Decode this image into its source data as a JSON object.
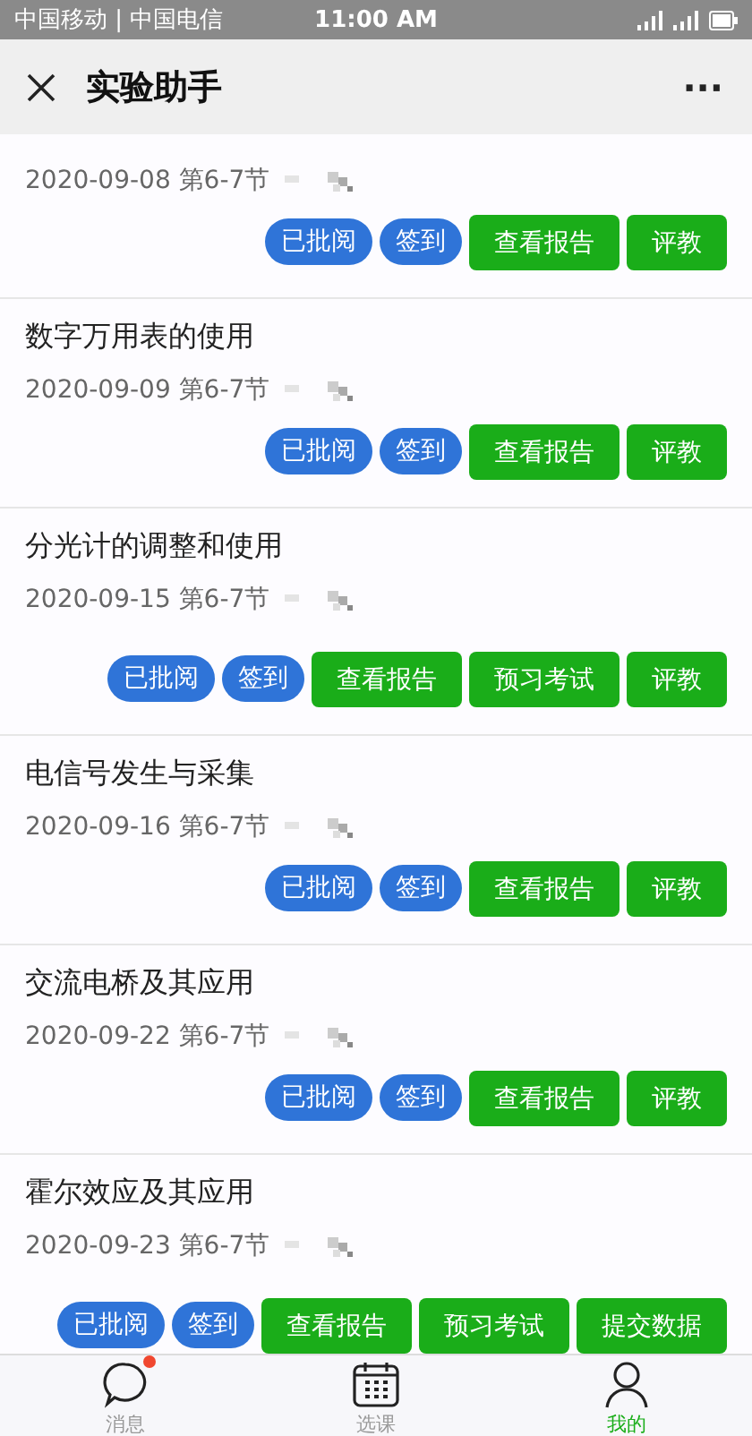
{
  "status_bar": {
    "carriers": "中国移动 | 中国电信",
    "time": "11:00 AM"
  },
  "header": {
    "title": "实验助手",
    "more": "···"
  },
  "experiments": [
    {
      "date": "2020-09-08 第6-7节",
      "actions": [
        {
          "label": "已批阅",
          "kind": "status"
        },
        {
          "label": "签到",
          "kind": "status"
        },
        {
          "label": "查看报告",
          "kind": "action"
        },
        {
          "label": "评教",
          "kind": "action"
        }
      ]
    },
    {
      "title": "数字万用表的使用",
      "date": "2020-09-09 第6-7节",
      "actions": [
        {
          "label": "已批阅",
          "kind": "status"
        },
        {
          "label": "签到",
          "kind": "status"
        },
        {
          "label": "查看报告",
          "kind": "action"
        },
        {
          "label": "评教",
          "kind": "action"
        }
      ]
    },
    {
      "title": "分光计的调整和使用",
      "date": "2020-09-15 第6-7节",
      "actions": [
        {
          "label": "已批阅",
          "kind": "status"
        },
        {
          "label": "签到",
          "kind": "status"
        },
        {
          "label": "查看报告",
          "kind": "action"
        },
        {
          "label": "预习考试",
          "kind": "action"
        },
        {
          "label": "评教",
          "kind": "action"
        }
      ]
    },
    {
      "title": "电信号发生与采集",
      "date": "2020-09-16 第6-7节",
      "actions": [
        {
          "label": "已批阅",
          "kind": "status"
        },
        {
          "label": "签到",
          "kind": "status"
        },
        {
          "label": "查看报告",
          "kind": "action"
        },
        {
          "label": "评教",
          "kind": "action"
        }
      ]
    },
    {
      "title": "交流电桥及其应用",
      "date": "2020-09-22 第6-7节",
      "actions": [
        {
          "label": "已批阅",
          "kind": "status"
        },
        {
          "label": "签到",
          "kind": "status"
        },
        {
          "label": "查看报告",
          "kind": "action"
        },
        {
          "label": "评教",
          "kind": "action"
        }
      ]
    },
    {
      "title": "霍尔效应及其应用",
      "date": "2020-09-23 第6-7节",
      "actions": [
        {
          "label": "已批阅",
          "kind": "status"
        },
        {
          "label": "签到",
          "kind": "status"
        },
        {
          "label": "查看报告",
          "kind": "action"
        },
        {
          "label": "预习考试",
          "kind": "action"
        },
        {
          "label": "提交数据",
          "kind": "action"
        }
      ]
    }
  ],
  "tabs": [
    {
      "label": "消息",
      "badge": true,
      "selected": false
    },
    {
      "label": "选课",
      "badge": false,
      "selected": false
    },
    {
      "label": "我的",
      "badge": false,
      "selected": true
    }
  ]
}
